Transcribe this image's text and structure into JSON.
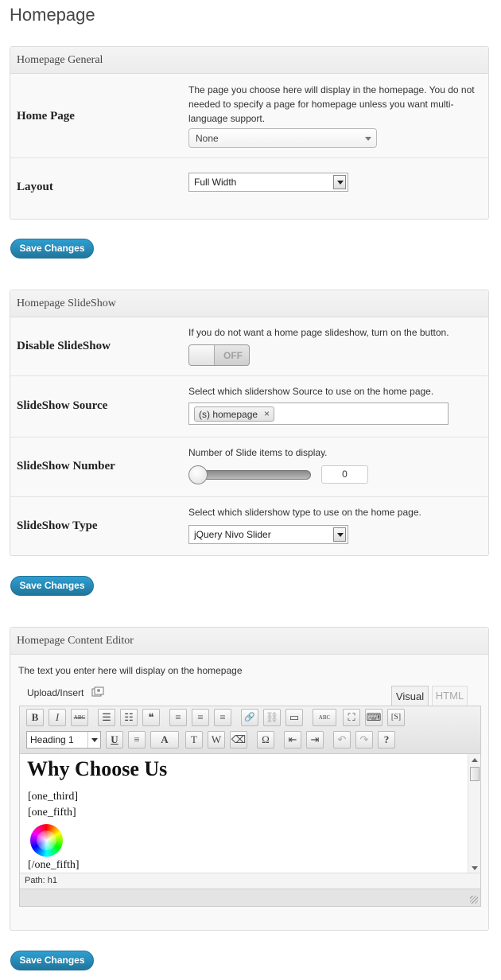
{
  "page_title": "Homepage",
  "general": {
    "header": "Homepage General",
    "home_page_label": "Home Page",
    "home_page_desc": "The page you choose here will display in the homepage. You do not needed to specify a page for homepage unless you want multi-language support.",
    "home_page_value": "None",
    "layout_label": "Layout",
    "layout_value": "Full Width"
  },
  "save_label": "Save Changes",
  "slideshow": {
    "header": "Homepage SlideShow",
    "disable_label": "Disable SlideShow",
    "disable_desc": "If you do not want a home page slideshow, turn on the button.",
    "toggle_text": "OFF",
    "source_label": "SlideShow Source",
    "source_desc": "Select which slidershow Source to use on the home page.",
    "source_tag": "(s) homepage",
    "source_tag_remove": "×",
    "number_label": "SlideShow Number",
    "number_desc": "Number of Slide items to display.",
    "number_value": "0",
    "type_label": "SlideShow Type",
    "type_desc": "Select which slidershow type to use on the home page.",
    "type_value": "jQuery Nivo Slider"
  },
  "content_editor": {
    "header": "Homepage Content Editor",
    "desc": "The text you enter here will display on the homepage",
    "upload_label": "Upload/Insert",
    "tab_visual": "Visual",
    "tab_html": "HTML",
    "format_select": "Heading 1",
    "toolbar_glyphs": {
      "bold": "B",
      "italic": "I",
      "strike": "ABC",
      "bullets": "☰",
      "numbers": "☷",
      "quote": "❝",
      "align_left": "≡",
      "align_center": "≡",
      "align_right": "≡",
      "link": "🔗",
      "unlink": "⛓",
      "more": "▭",
      "spell": "ABC",
      "fullscreen": "⛶",
      "kitchen": "⌨",
      "shortcode": "[S]",
      "underline": "U",
      "justify": "≡",
      "text_color": "A",
      "paste_text": "T",
      "paste_word": "W",
      "eraser": "⌫",
      "omega": "Ω",
      "outdent": "⇤",
      "indent": "⇥",
      "undo": "↶",
      "redo": "↷",
      "help": "?"
    },
    "content_heading": "Why Choose Us",
    "lines": [
      "[one_third]",
      "[one_fifth]",
      "[/one_fifth]"
    ],
    "path_label": "Path:",
    "path_value": "h1"
  }
}
